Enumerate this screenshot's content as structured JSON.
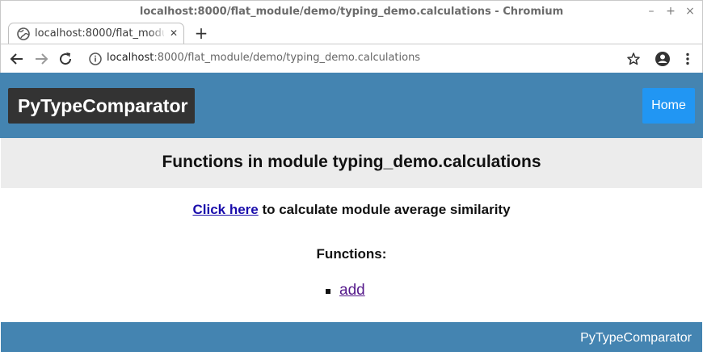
{
  "window": {
    "title": "localhost:8000/flat_module/demo/typing_demo.calculations - Chromium",
    "minimize_glyph": "–",
    "maximize_glyph": "+",
    "close_glyph": "×"
  },
  "tab": {
    "title": "localhost:8000/flat_module/demo/typing_demo.calculations",
    "close_glyph": "✕",
    "new_tab_glyph": "+"
  },
  "addressbar": {
    "host": "localhost",
    "path": ":8000/flat_module/demo/typing_demo.calculations"
  },
  "icons": {
    "back": "arrow-left-icon",
    "forward": "arrow-right-icon",
    "reload": "reload-icon",
    "info": "info-icon",
    "star": "star-icon",
    "account": "account-icon",
    "menu": "kebab-menu-icon",
    "favicon": "globe-icon"
  },
  "header": {
    "brand": "PyTypeComparator",
    "home": "Home"
  },
  "main": {
    "title": "Functions in module typing_demo.calculations",
    "calc_link": "Click here",
    "calc_text": " to calculate module average similarity",
    "functions_heading": "Functions:",
    "functions": [
      "add"
    ]
  },
  "footer": {
    "text": "PyTypeComparator"
  },
  "colors": {
    "header_bg": "#4484b1",
    "brand_bg": "#333333",
    "home_bg": "#2196f3",
    "title_band_bg": "#ececec",
    "link": "#1a0dab",
    "visited_link": "#551a8b"
  }
}
